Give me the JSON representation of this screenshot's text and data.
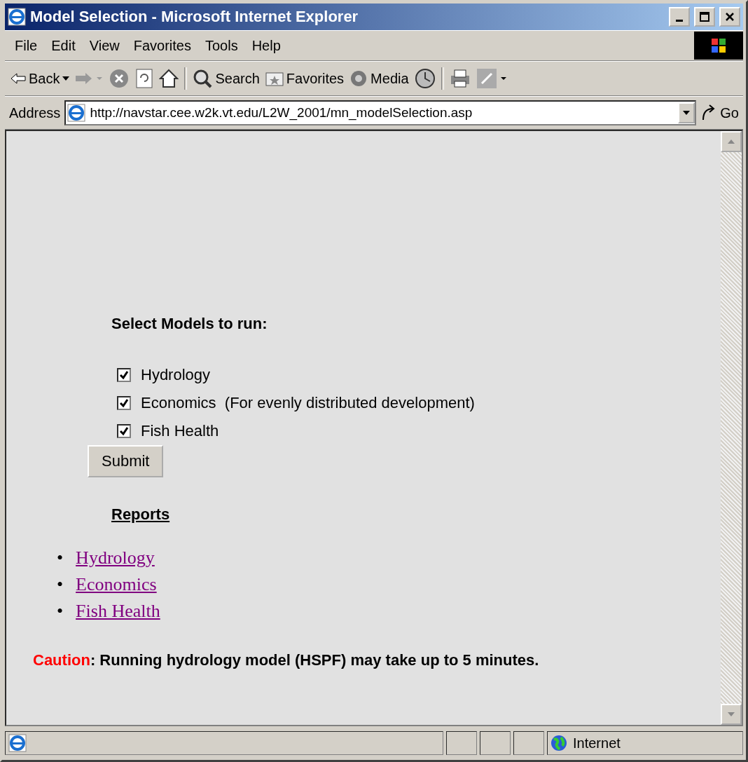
{
  "window": {
    "title": "Model Selection - Microsoft Internet Explorer"
  },
  "menu": [
    "File",
    "Edit",
    "View",
    "Favorites",
    "Tools",
    "Help"
  ],
  "toolbar": {
    "back": "Back",
    "search": "Search",
    "favorites": "Favorites",
    "media": "Media"
  },
  "address": {
    "label": "Address",
    "value": "http://navstar.cee.w2k.vt.edu/L2W_2001/mn_modelSelection.asp",
    "go": "Go"
  },
  "form": {
    "heading": "Select Models to run:",
    "models": [
      {
        "label": "Hydrology",
        "checked": true
      },
      {
        "label": "Economics  (For evenly distributed development)",
        "checked": true
      },
      {
        "label": "Fish Health",
        "checked": true
      }
    ],
    "submit": "Submit"
  },
  "reports": {
    "heading": "Reports",
    "links": [
      {
        "bullet": "•",
        "label": "Hydrology"
      },
      {
        "bullet": "•",
        "label": "Economics"
      },
      {
        "bullet": "•",
        "label": "Fish Health"
      }
    ]
  },
  "caution": {
    "label": "Caution",
    "text": ": Running hydrology model (HSPF) may take up to 5 minutes."
  },
  "status_bar": {
    "zone": "Internet"
  }
}
